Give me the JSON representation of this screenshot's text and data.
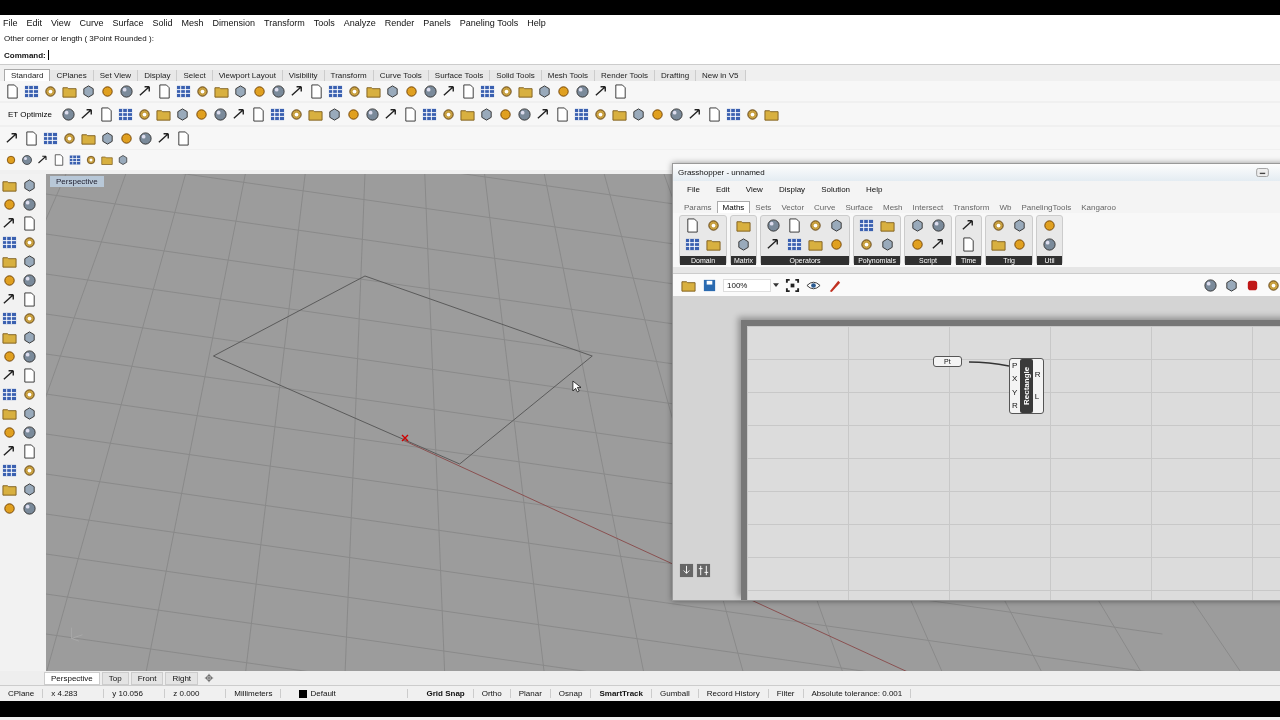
{
  "menu": [
    "File",
    "Edit",
    "View",
    "Curve",
    "Surface",
    "Solid",
    "Mesh",
    "Dimension",
    "Transform",
    "Tools",
    "Analyze",
    "Render",
    "Panels",
    "Paneling Tools",
    "Help"
  ],
  "command_history": "Other corner or length ( 3Point  Rounded ):",
  "command": {
    "label": "Command:"
  },
  "toolbar_tabs": [
    {
      "label": "Standard",
      "selected": true
    },
    {
      "label": "CPlanes",
      "selected": false
    },
    {
      "label": "Set View",
      "selected": false
    },
    {
      "label": "Display",
      "selected": false
    },
    {
      "label": "Select",
      "selected": false
    },
    {
      "label": "Viewport Layout",
      "selected": false
    },
    {
      "label": "Visibility",
      "selected": false
    },
    {
      "label": "Transform",
      "selected": false
    },
    {
      "label": "Curve Tools",
      "selected": false
    },
    {
      "label": "Surface Tools",
      "selected": false
    },
    {
      "label": "Solid Tools",
      "selected": false
    },
    {
      "label": "Mesh Tools",
      "selected": false
    },
    {
      "label": "Render Tools",
      "selected": false
    },
    {
      "label": "Drafting",
      "selected": false
    },
    {
      "label": "New in V5",
      "selected": false
    }
  ],
  "optimize_button": "ET Optimize",
  "viewport": {
    "label": "Perspective"
  },
  "viewport_tabs": [
    {
      "label": "Perspective",
      "selected": true
    },
    {
      "label": "Top",
      "selected": false
    },
    {
      "label": "Front",
      "selected": false
    },
    {
      "label": "Right",
      "selected": false
    }
  ],
  "status_bar": [
    {
      "kind": "cell",
      "text": "CPlane"
    },
    {
      "kind": "coord",
      "text": "x 4.283"
    },
    {
      "kind": "coord",
      "text": "y 10.056"
    },
    {
      "kind": "coord",
      "text": "z 0.000"
    },
    {
      "kind": "cell",
      "text": "Millimeters"
    },
    {
      "kind": "layer",
      "text": "Default",
      "color": "#000000"
    },
    {
      "kind": "toggle",
      "text": "Grid Snap",
      "on": true
    },
    {
      "kind": "toggle",
      "text": "Ortho",
      "on": false
    },
    {
      "kind": "toggle",
      "text": "Planar",
      "on": false
    },
    {
      "kind": "toggle",
      "text": "Osnap",
      "on": false
    },
    {
      "kind": "toggle",
      "text": "SmartTrack",
      "on": true
    },
    {
      "kind": "toggle",
      "text": "Gumball",
      "on": false
    },
    {
      "kind": "toggle",
      "text": "Record History",
      "on": false
    },
    {
      "kind": "toggle",
      "text": "Filter",
      "on": false
    },
    {
      "kind": "cell",
      "text": "Absolute tolerance: 0.001"
    }
  ],
  "grasshopper": {
    "title": "Grasshopper - unnamed",
    "menu": [
      "File",
      "Edit",
      "View",
      "Display",
      "Solution",
      "Help"
    ],
    "tabs": [
      {
        "label": "Params",
        "selected": false
      },
      {
        "label": "Maths",
        "selected": true
      },
      {
        "label": "Sets",
        "selected": false
      },
      {
        "label": "Vector",
        "selected": false
      },
      {
        "label": "Curve",
        "selected": false
      },
      {
        "label": "Surface",
        "selected": false
      },
      {
        "label": "Mesh",
        "selected": false
      },
      {
        "label": "Intersect",
        "selected": false
      },
      {
        "label": "Transform",
        "selected": false
      },
      {
        "label": "Wb",
        "selected": false
      },
      {
        "label": "PanelingTools",
        "selected": false
      },
      {
        "label": "Kangaroo",
        "selected": false
      }
    ],
    "groups": [
      "Domain",
      "Matrix",
      "Operators",
      "Polynomials",
      "Script",
      "Time",
      "Trig",
      "Util"
    ],
    "zoom": "100%",
    "components": [
      {
        "kind": "param",
        "label": "Pt"
      },
      {
        "kind": "component",
        "label": "Rectangle",
        "inputs": [
          "P",
          "X",
          "Y",
          "R"
        ],
        "outputs": [
          "R",
          "L"
        ]
      }
    ]
  }
}
